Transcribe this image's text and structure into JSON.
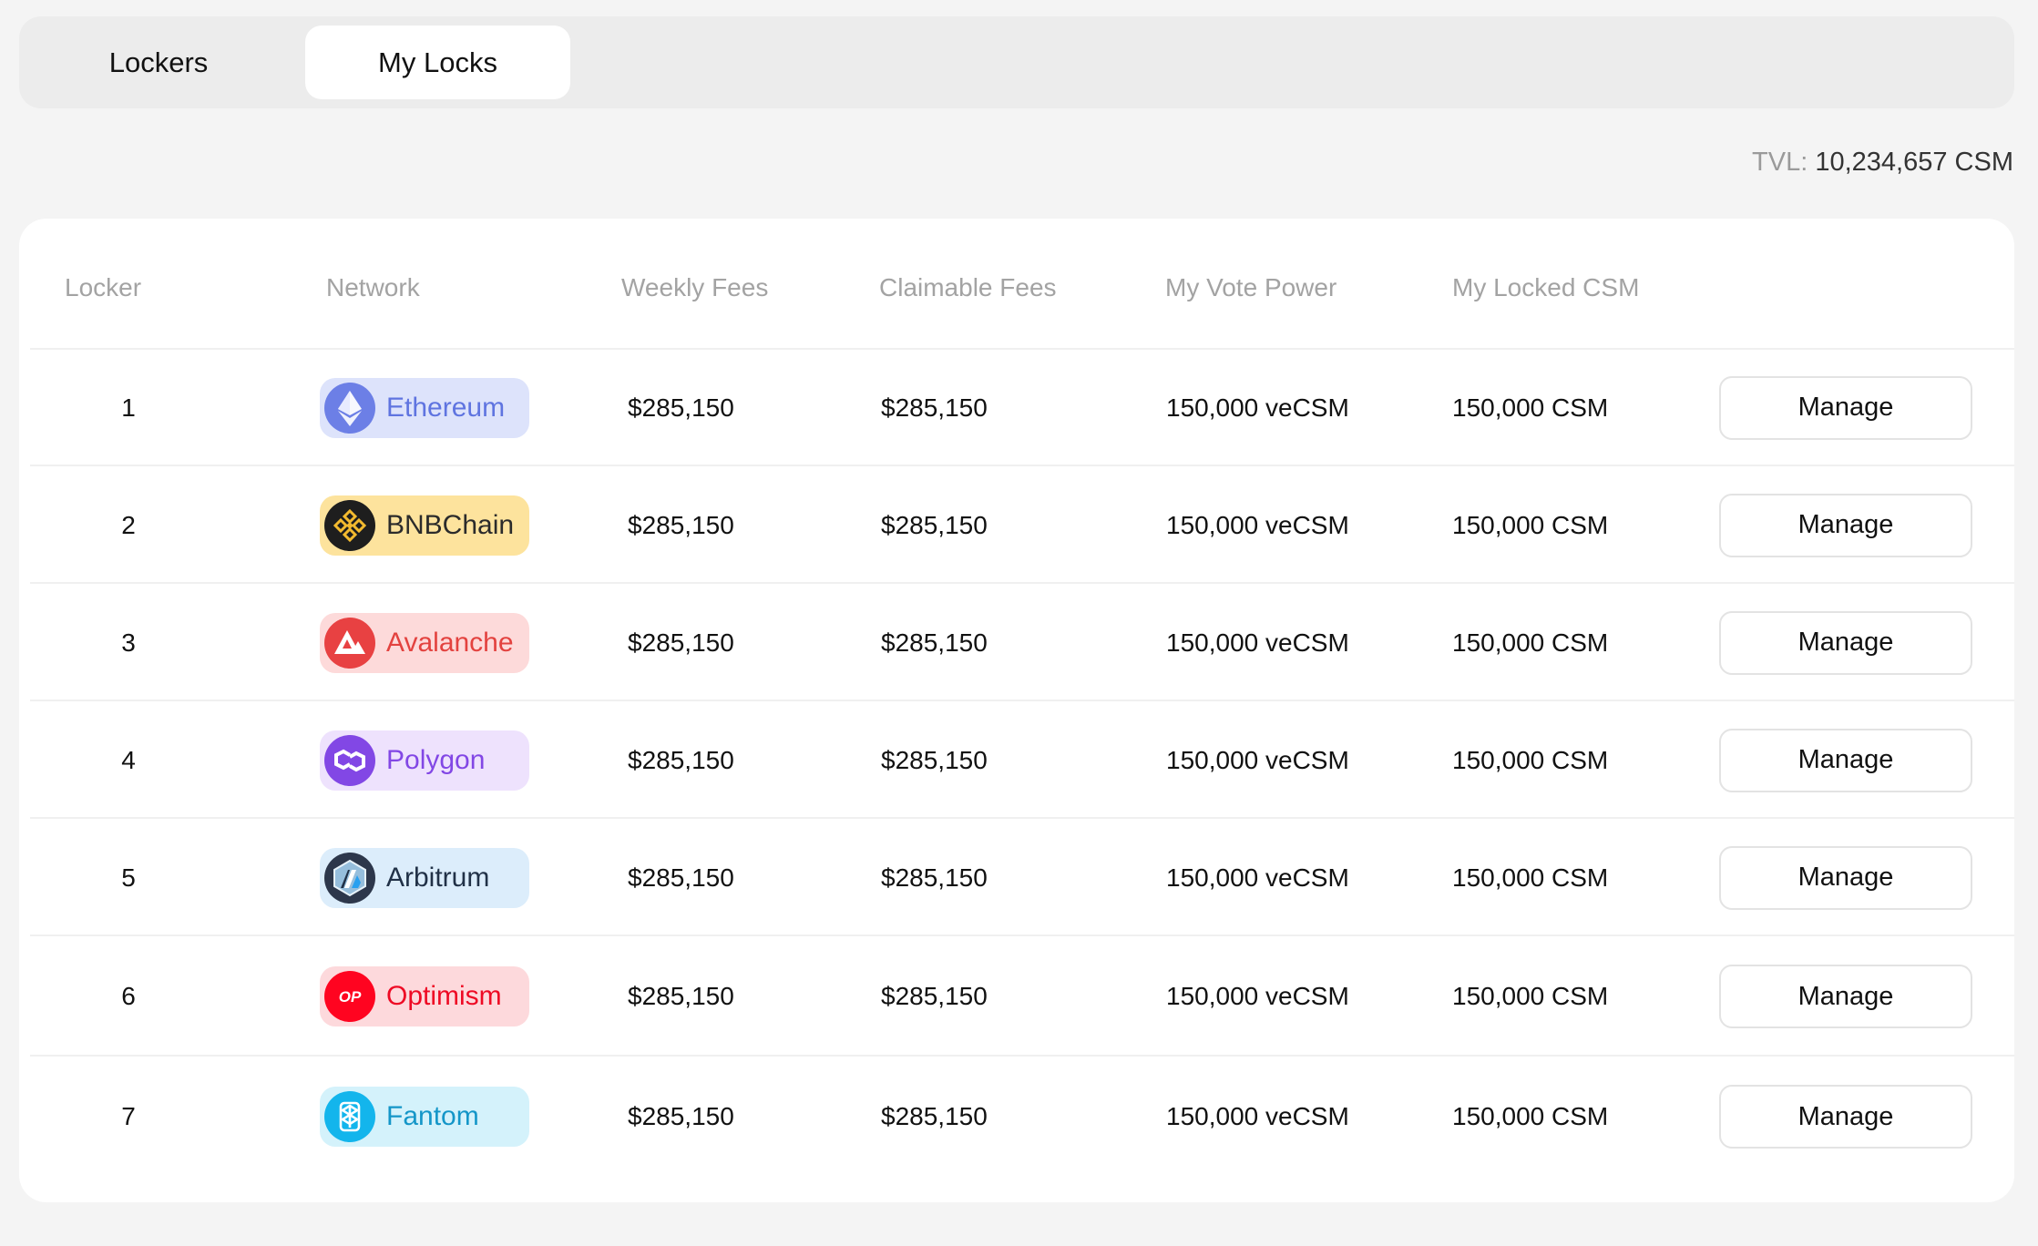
{
  "tabs": [
    {
      "label": "Lockers"
    },
    {
      "label": "My Locks"
    }
  ],
  "tvl": {
    "label": "TVL:",
    "value": "10,234,657 CSM"
  },
  "table": {
    "headers": {
      "locker": "Locker",
      "network": "Network",
      "weekly_fees": "Weekly Fees",
      "claimable_fees": "Claimable Fees",
      "vote_power": "My Vote Power",
      "locked": "My Locked CSM"
    },
    "rows": [
      {
        "index": "1",
        "network": "Ethereum",
        "weekly_fees": "$285,150",
        "claimable_fees": "$285,150",
        "vote_power": "150,000 veCSM",
        "locked": "150,000 CSM",
        "action": "Manage",
        "pill_bg": "#dde3fb",
        "text_color": "#5f74e0",
        "icon_bg": "#6c7fe6",
        "icon": "ethereum-icon"
      },
      {
        "index": "2",
        "network": "BNBChain",
        "weekly_fees": "$285,150",
        "claimable_fees": "$285,150",
        "vote_power": "150,000 veCSM",
        "locked": "150,000 CSM",
        "action": "Manage",
        "pill_bg": "#fde39d",
        "text_color": "#2b2b2b",
        "icon_bg": "#1e1e1e",
        "icon": "bnb-icon"
      },
      {
        "index": "3",
        "network": "Avalanche",
        "weekly_fees": "$285,150",
        "claimable_fees": "$285,150",
        "vote_power": "150,000 veCSM",
        "locked": "150,000 CSM",
        "action": "Manage",
        "pill_bg": "#fddada",
        "text_color": "#e3423f",
        "icon_bg": "#e84142",
        "icon": "avalanche-icon"
      },
      {
        "index": "4",
        "network": "Polygon",
        "weekly_fees": "$285,150",
        "claimable_fees": "$285,150",
        "vote_power": "150,000 veCSM",
        "locked": "150,000 CSM",
        "action": "Manage",
        "pill_bg": "#eee2fd",
        "text_color": "#8247e5",
        "icon_bg": "#8247e5",
        "icon": "polygon-icon"
      },
      {
        "index": "5",
        "network": "Arbitrum",
        "weekly_fees": "$285,150",
        "claimable_fees": "$285,150",
        "vote_power": "150,000 veCSM",
        "locked": "150,000 CSM",
        "action": "Manage",
        "pill_bg": "#dcedfb",
        "text_color": "#213147",
        "icon_bg": "#2d374b",
        "icon": "arbitrum-icon"
      },
      {
        "index": "6",
        "network": "Optimism",
        "weekly_fees": "$285,150",
        "claimable_fees": "$285,150",
        "vote_power": "150,000 veCSM",
        "locked": "150,000 CSM",
        "action": "Manage",
        "pill_bg": "#fdd9dc",
        "text_color": "#ee0a24",
        "icon_bg": "#ff0420",
        "icon": "optimism-icon"
      },
      {
        "index": "7",
        "network": "Fantom",
        "weekly_fees": "$285,150",
        "claimable_fees": "$285,150",
        "vote_power": "150,000 veCSM",
        "locked": "150,000 CSM",
        "action": "Manage",
        "pill_bg": "#d4f2fb",
        "text_color": "#1496c8",
        "icon_bg": "#13b5ec",
        "icon": "fantom-icon"
      }
    ]
  }
}
